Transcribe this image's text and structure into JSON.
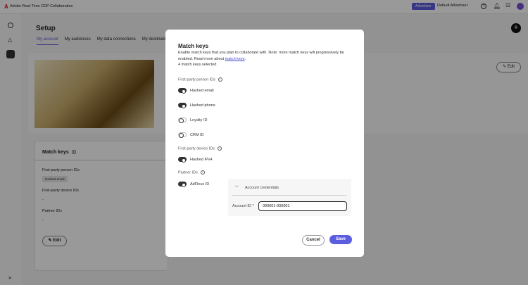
{
  "app": {
    "title": "Adobe Real-Time CDP Collaboration",
    "role_badge": "Advertiser",
    "account": "Default Advertiser"
  },
  "colors": {
    "accent": "#5c5ce0",
    "brand": "#eb1000"
  },
  "page": {
    "title": "Setup",
    "tabs": [
      "My account",
      "My audiences",
      "My data connections",
      "My destinations"
    ],
    "edit_label": "Edit"
  },
  "match_card": {
    "title": "Match keys",
    "sections": [
      {
        "label": "First-party person IDs",
        "tag": "Hashed email"
      },
      {
        "label": "First-party device IDs",
        "value": "-"
      },
      {
        "label": "Partner IDs",
        "value": "-"
      }
    ],
    "edit_label": "Edit"
  },
  "modal": {
    "title": "Match keys",
    "description": "Enable match keys that you plan to collaborate with. Note: more match keys will progressively be enabled. Read more about ",
    "link": "match keys",
    "period": ".",
    "count": "4 match keys selected",
    "groups": [
      {
        "label": "First-party person IDs",
        "items": [
          {
            "label": "Hashed email",
            "on": true
          },
          {
            "label": "Hashed phone",
            "on": true
          },
          {
            "label": "Loyalty ID",
            "on": false
          },
          {
            "label": "CRM ID",
            "on": false
          }
        ]
      },
      {
        "label": "First-party device IDs",
        "items": [
          {
            "label": "Hashed IPv4",
            "on": true
          }
        ]
      },
      {
        "label": "Partner IDs",
        "items": [
          {
            "label": "AdFleus ID",
            "on": true
          }
        ]
      }
    ],
    "credentials": {
      "header": "Account credentials",
      "field_label": "Account ID",
      "required": "*",
      "value": "000001-000001"
    },
    "cancel": "Cancel",
    "save": "Save"
  }
}
